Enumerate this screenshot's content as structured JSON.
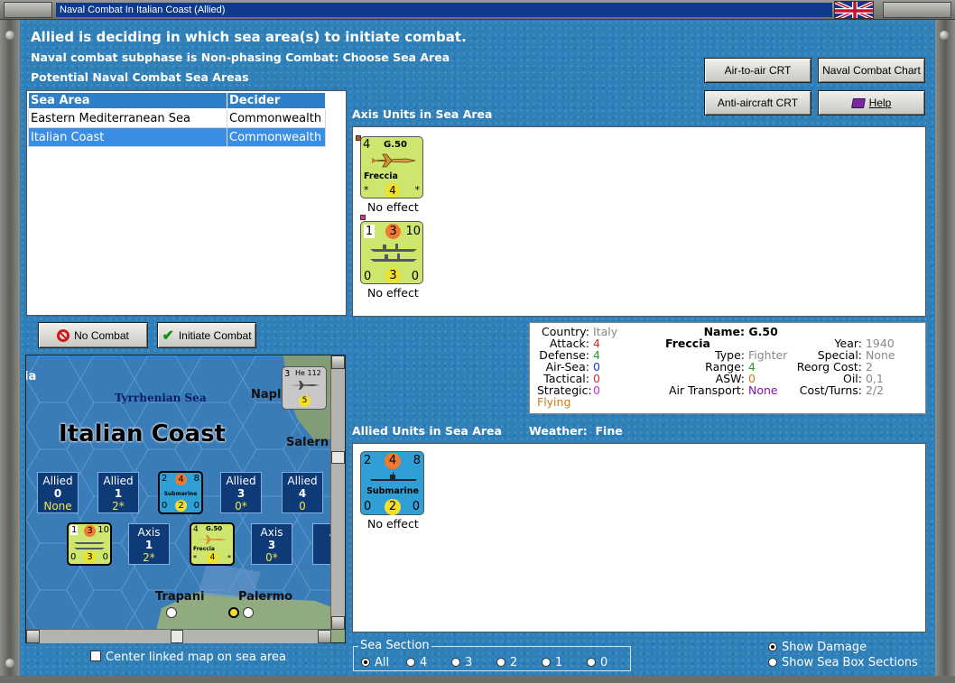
{
  "window": {
    "title": "Naval Combat In Italian Coast (Allied)"
  },
  "header": {
    "line1": "Allied is deciding in which sea area(s) to initiate combat.",
    "line2": "Naval combat subphase is Non-phasing Combat: Choose Sea Area",
    "line3": "Potential Naval Combat Sea Areas"
  },
  "charts": {
    "air_to_air": "Air-to-air CRT",
    "naval_combat": "Naval Combat Chart",
    "anti_aircraft": "Anti-aircraft CRT",
    "help": "Help"
  },
  "sea_table": {
    "columns": [
      "Sea Area",
      "Decider"
    ],
    "rows": [
      {
        "area": "Eastern Mediterranean Sea",
        "decider": "Commonwealth",
        "selected": false
      },
      {
        "area": "Italian Coast",
        "decider": "Commonwealth",
        "selected": true
      }
    ]
  },
  "axis_units": {
    "label": "Axis Units in Sea Area",
    "units": [
      {
        "top_left": "4",
        "name": "G.50",
        "subname": "Freccia",
        "bottom": "4",
        "star_l": "*",
        "star_r": "*",
        "star_tl": "*",
        "status": "No effect"
      },
      {
        "top_left": "1",
        "top_mid": "3",
        "top_right": "10",
        "bottom_left": "0",
        "bottom_mid": "3",
        "bottom_right": "0",
        "status": "No effect"
      }
    ]
  },
  "actions": {
    "no_combat": "No Combat",
    "initiate_combat": "Initiate Combat"
  },
  "unit_info": {
    "country_k": "Country:",
    "country_v": "Italy",
    "attack_k": "Attack:",
    "attack_v": "4",
    "defense_k": "Defense:",
    "defense_v": "4",
    "airsea_k": "Air-Sea:",
    "airsea_v": "0",
    "tactical_k": "Tactical:",
    "tactical_v": "0",
    "strategic_k": "Strategic:",
    "strategic_v": "0",
    "flying": "Flying",
    "name_k": "Name:",
    "name_v": "G.50 Freccia",
    "type_k": "Type:",
    "type_v": "Fighter",
    "range_k": "Range:",
    "range_v": "4",
    "asw_k": "ASW:",
    "asw_v": "0",
    "airtransport_k": "Air Transport:",
    "airtransport_v": "None",
    "year_k": "Year:",
    "year_v": "1940",
    "special_k": "Special:",
    "special_v": "None",
    "reorg_k": "Reorg Cost:",
    "reorg_v": "2",
    "oil_k": "Oil:",
    "oil_v": "0,1",
    "cost_k": "Cost/Turns:",
    "cost_v": "2/2",
    "colors": {
      "attack": "#d03030",
      "defense": "#2a9a2a",
      "airsea": "#1a3ad0",
      "tactical": "#d03030",
      "strategic": "#d030d0",
      "flying": "#d07a10",
      "grey": "#888888",
      "asw": "#d07a10",
      "airtransport": "#8a10b0"
    }
  },
  "allied_units": {
    "label": "Allied Units in Sea Area",
    "weather_k": "Weather:",
    "weather_v": "Fine",
    "units": [
      {
        "top_left": "2",
        "top_mid": "4",
        "top_right": "8",
        "name": "Submarine",
        "bottom_left": "0",
        "bottom_mid": "2",
        "bottom_right": "0",
        "status": "No effect"
      }
    ]
  },
  "map": {
    "title": "Italian Coast",
    "sea": "Tyrrhenian Sea",
    "cities": [
      "Napl",
      "Salern",
      "Trapani",
      "Palermo",
      "ia"
    ],
    "he112_atk": "3",
    "he112_name": "He 112",
    "he112_rng": "5",
    "boxes_row1": [
      {
        "side": "Allied",
        "n": "0",
        "sub": "None"
      },
      {
        "side": "Allied",
        "n": "1",
        "sub": "2*"
      },
      {
        "side": "Allied",
        "n": "3",
        "sub": "0*"
      },
      {
        "side": "Allied",
        "n": "4",
        "sub": "0"
      }
    ],
    "sub_counter": {
      "tl": "2",
      "tm": "4",
      "tr": "8",
      "name": "Submarine",
      "bl": "0",
      "bm": "2",
      "br": "0"
    },
    "boxes_row2": [
      {
        "side": "Axis",
        "n": "1",
        "sub": "2*"
      },
      {
        "side": "Axis",
        "n": "3",
        "sub": "0*"
      },
      {
        "side": "A",
        "n": "",
        "sub": ""
      }
    ],
    "ship_counter": {
      "tl": "1",
      "tm": "3",
      "tr": "10",
      "bl": "0",
      "bm": "3",
      "br": "0"
    },
    "g50_counter": {
      "tl": "4",
      "name": "G.50",
      "sub": "Freccia",
      "bm": "4",
      "sl": "*",
      "sr": "*"
    }
  },
  "center_map_label": "Center linked map on sea area",
  "sea_section": {
    "title": "Sea Section",
    "options": [
      "All",
      "4",
      "3",
      "2",
      "1",
      "0"
    ],
    "selected": "All"
  },
  "display": {
    "show_damage": "Show Damage",
    "show_sections": "Show Sea Box Sections",
    "selected": "show_damage"
  }
}
